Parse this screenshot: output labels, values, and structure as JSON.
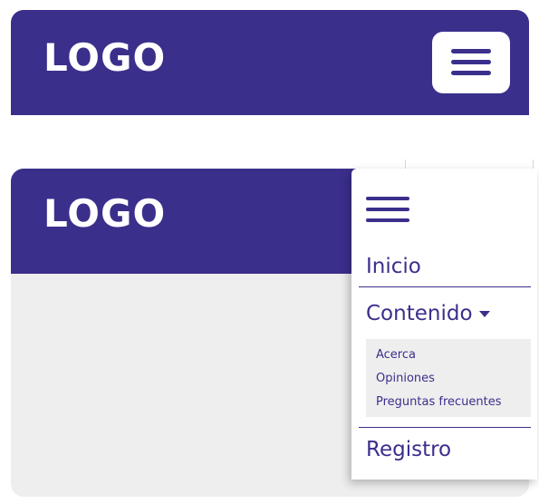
{
  "header_collapsed": {
    "logo": "LOGO"
  },
  "header_expanded": {
    "logo": "LOGO"
  },
  "menu": {
    "items": [
      "Inicio",
      "Contenido",
      "Registro"
    ],
    "submenu": [
      "Acerca",
      "Opiniones",
      "Preguntas frecuentes"
    ]
  },
  "colors": {
    "brand": "#3b2f8c",
    "panel": "#eeeeee",
    "surface": "#ffffff"
  }
}
